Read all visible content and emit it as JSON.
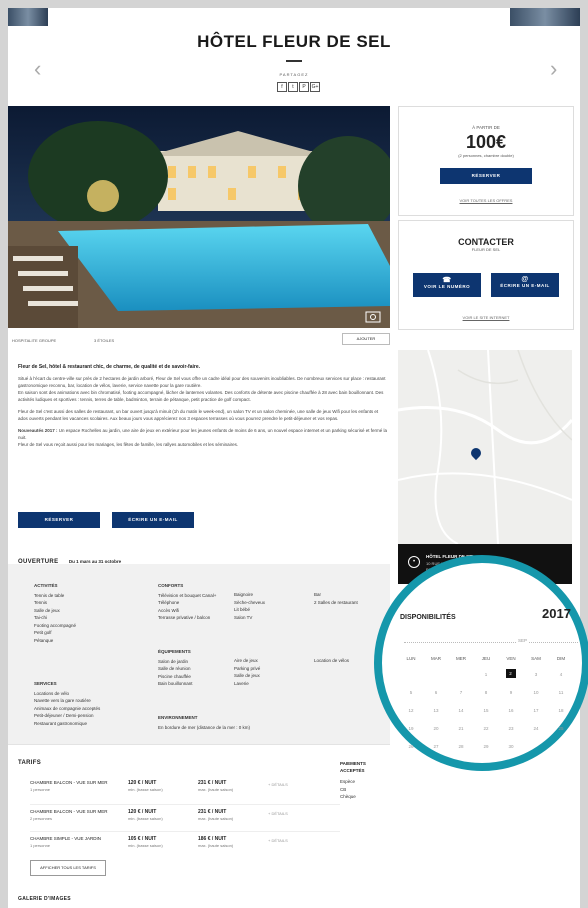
{
  "hotel": {
    "name": "HÔTEL FLEUR DE SEL"
  },
  "share": {
    "label": "PARTAGEZ",
    "icons": [
      "facebook-icon",
      "twitter-icon",
      "pinterest-icon",
      "google-plus-icon"
    ],
    "glyphs": [
      "f",
      "t",
      "P",
      "G+"
    ]
  },
  "nav": {
    "prev": "‹",
    "next": "›"
  },
  "photo_meta": {
    "left": "HOSPITALITE GROUPE",
    "stars": "3 ÉTOILES",
    "add_label": "AJOUTER"
  },
  "price_box": {
    "from_label": "À PARTIR DE",
    "price": "100€",
    "note": "(2 personnes, chambre double)",
    "book_label": "RÉSERVER",
    "link": "VOIR TOUTES LES OFFRES"
  },
  "contact_box": {
    "title": "CONTACTER",
    "subtitle": "FLEUR DE SEL",
    "phone_label": "VOIR LE NUMÉRO",
    "mail_label": "ÉCRIRE UN E-MAIL",
    "link": "VOIR LE SITE INTERNET"
  },
  "description": {
    "title": "Fleur de Sel, hôtel & restaurant chic, de charme, de qualité et de savoir-faire.",
    "p1": "Situé à l'écart du centre-ville sur près de 2 hectares de jardin arboré, Fleur de Sel vous offre un cadre idéal pour des souvenirs inoubliables. De nombreux services sur place : restaurant gastronomique reconnu, bar, location de vélos, laverie, service navette pour la gare routière.",
    "p2": "En saison sont des animations avec bin chromatisé, footing accompagné, lâcher de lanternes volantes. Des conforts de détente avec piscine chauffée à 28 avec bain bouillonnant. Des activités ludiques et sportives : tennis, terres de table, badminton, terrain de pétanque, petit practice de golf compact.",
    "p3": "Fleur de Sel c'est aussi des salles de restaurant, un bar ouvert jusqu'à minuit (1h du matin le week-end), un salon TV et un salon cheminée, une salle de jeux Wifi pour les enfants et ados ouverts pendant les vacances scolaires. Aux beaux jours vous apprécierez nos 3 espaces terrasses où vous pourrez prendre le petit-déjeuner et vos repas.",
    "p4_bold": "Nouveautés 2017 :",
    "p4": " Un espace Rochelles au jardin, une aire de jeux en extérieur pour les jeunes enfants de moins de 6 ans, un nouvel espace internet et un parking sécurisé et fermé la nuit.",
    "p5": "Fleur de Sel vous reçoit aussi pour les mariages, les fêtes de famille, les rallyes automobiles et les séminaires.",
    "book_label": "RÉSERVER",
    "mail_label": "ÉCRIRE UN E-MAIL"
  },
  "opening": {
    "title": "OUVERTURE",
    "range": "Du 1 mars au 31 octobre"
  },
  "activities": {
    "title": "ACTIVITÉS",
    "items": [
      "Tennis de table",
      "Tennis",
      "Salle de jeux",
      "Tai-chi",
      "Footing accompagné",
      "Petit golf",
      "Pétanque"
    ]
  },
  "services": {
    "title": "SERVICES",
    "items": [
      "Locations de vélo",
      "Navette vers la gare routière",
      "Animaux de compagnie acceptés",
      "Petit-déjeuner / Demi-pension",
      "Restaurant gastronomique"
    ]
  },
  "comforts": {
    "title": "CONFORTS",
    "col1": [
      "Télévision et bouquet Canal+",
      "Téléphone",
      "Accès Wifi",
      "Terrasse privative / balcon"
    ],
    "col2": [
      "Baignoire",
      "Sèche-cheveux",
      "Lit bébé",
      "Salon TV"
    ],
    "col3": [
      "Bar",
      "2 Salles de restaurant"
    ]
  },
  "equipment": {
    "title": "ÉQUIPEMENTS",
    "col1": [
      "Salon de jardin",
      "Salle de réunion",
      "Piscine chauffée",
      "Bain bouillonnant"
    ],
    "col2": [
      "Aire de jeux",
      "Parking privé",
      "Salle de jeux",
      "Laverie"
    ],
    "col3": [
      "Location de vélos"
    ]
  },
  "environment": {
    "title": "ENVIRONNEMENT",
    "text": "En bordure de mer (distance de la mer : 0 km)"
  },
  "map": {
    "name": "HÔTEL FLEUR DE SEL",
    "addr1": "10 RUE DES TAMARIS",
    "addr2": "BP 207"
  },
  "calendar": {
    "title": "DISPONIBILITÉS",
    "year": "2017",
    "month": "SEP",
    "days": [
      "LUN",
      "MAR",
      "MER",
      "JEU",
      "VEN",
      "SAM",
      "DIM"
    ],
    "weeks": [
      [
        "",
        "",
        "",
        "1",
        "2",
        "3",
        "4"
      ],
      [
        "5",
        "6",
        "7",
        "8",
        "9",
        "10",
        "11"
      ],
      [
        "12",
        "13",
        "14",
        "15",
        "16",
        "17",
        "18"
      ],
      [
        "19",
        "20",
        "21",
        "22",
        "23",
        "24",
        "25"
      ],
      [
        "26",
        "27",
        "28",
        "29",
        "30",
        "",
        ""
      ]
    ]
  },
  "tarifs": {
    "title": "TARIFS",
    "detail_label": "+ DÉTAILS",
    "show_all": "AFFICHER TOUS LES TARIFS",
    "rows": [
      {
        "name": "CHAMBRE BALCON - VUE SUR MER",
        "sub": "1 personne",
        "p1": "120 € / NUIT",
        "p1s": "min. (basse saison)",
        "p2": "231 € / NUIT",
        "p2s": "max. (haute saison)"
      },
      {
        "name": "CHAMBRE BALCON - VUE SUR MER",
        "sub": "2 personnes",
        "p1": "120 € / NUIT",
        "p1s": "min. (basse saison)",
        "p2": "231 € / NUIT",
        "p2s": "max. (haute saison)"
      },
      {
        "name": "CHAMBRE SIMPLE - VUE JARDIN",
        "sub": "1 personne",
        "p1": "105 € / NUIT",
        "p1s": "min. (basse saison)",
        "p2": "186 € / NUIT",
        "p2s": "max. (haute saison)"
      }
    ]
  },
  "payments": {
    "title1": "PAIEMENTS",
    "title2": "ACCEPTÉS",
    "items": [
      "Espèce",
      "CB",
      "Chèque"
    ]
  },
  "gallery": {
    "title": "GALERIE D'IMAGES"
  },
  "colors": {
    "primary": "#0d3570",
    "accent": "#1597ab"
  }
}
